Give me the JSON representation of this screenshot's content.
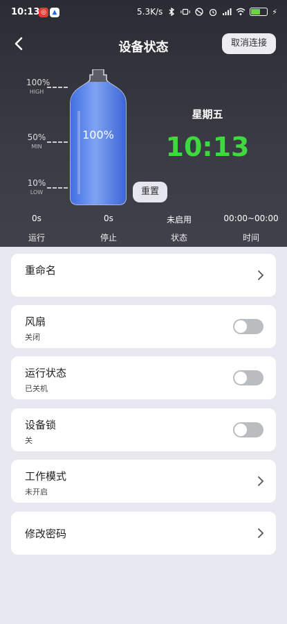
{
  "status_bar": {
    "time": "10:13",
    "net_speed": "5.3K/s",
    "battery_level": "51",
    "accent_colors": {
      "app1": "#e53935",
      "app2": "#1e66f5",
      "battery": "#6cd44c"
    }
  },
  "header": {
    "title": "设备状态",
    "disconnect_label": "取消连接",
    "back_icon": "chevron-left-icon"
  },
  "gauge": {
    "levels": [
      {
        "percent": "100%",
        "tag": "HIGH"
      },
      {
        "percent": "50%",
        "tag": "MIN"
      },
      {
        "percent": "10%",
        "tag": "LOW"
      }
    ],
    "fill_fraction": 1.0,
    "fill_text": "100%",
    "reset_label": "重置",
    "bottle_color": "#4f7ee6"
  },
  "clock": {
    "weekday": "星期五",
    "time": "10:13",
    "color": "#3fd83f"
  },
  "stats": [
    {
      "value": "0s",
      "label": "运行"
    },
    {
      "value": "0s",
      "label": "停止"
    },
    {
      "value": "未启用",
      "label": "状态"
    },
    {
      "value": "00:00~00:00",
      "label": "时间"
    }
  ],
  "settings": {
    "rename": {
      "title": "重命名"
    },
    "fan": {
      "title": "风扇",
      "status": "关闭",
      "on": false
    },
    "run_state": {
      "title": "运行状态",
      "status": "已关机",
      "on": false
    },
    "device_lock": {
      "title": "设备锁",
      "status": "关",
      "on": false
    },
    "work_mode": {
      "title": "工作模式",
      "status": "未开启"
    },
    "change_password": {
      "title": "修改密码"
    }
  }
}
